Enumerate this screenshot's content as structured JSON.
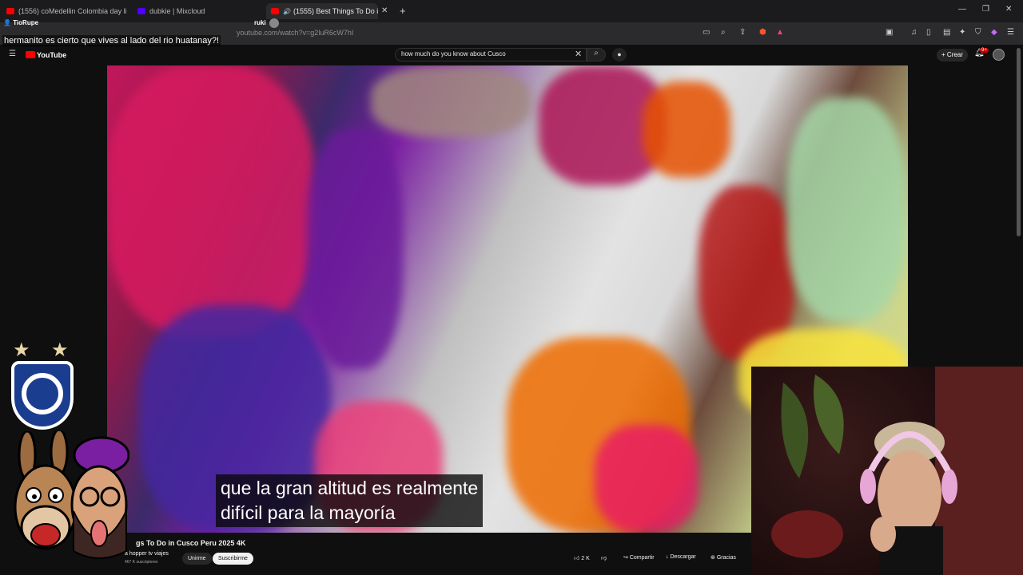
{
  "tabs": [
    {
      "label": "(1556) coMedellin Colombia day life",
      "favicon_color": "#ff0000"
    },
    {
      "label": "dubkie | Mixcloud",
      "favicon_color": "#5000ff"
    },
    {
      "label": "(1555) Best Things To Do in C",
      "favicon_color": "#ff0000",
      "active": true
    }
  ],
  "browser": {
    "url": "youtube.com/watch?v=g2luR6cW7hI"
  },
  "chat": {
    "user": "TioRupe",
    "user2": "ruki",
    "message": "hermanito es cierto que vives al lado del rio huatanay?!"
  },
  "youtube": {
    "logo_text": "YouTube",
    "search_query": "how much do you know about Cusco",
    "create_label": "Crear",
    "notification_count": "9+"
  },
  "video": {
    "caption_line1": "que la gran altitud es realmente",
    "caption_line2": "difícil para la mayoría",
    "title": "gs To Do in Cusco Peru 2025 4K",
    "channel": "a hopper tv viajes",
    "subscribers": "467 K suscriptores",
    "join_label": "Unirme",
    "subscribe_label": "Suscribirme",
    "likes": "2 K",
    "share_label": "Compartir",
    "download_label": "Descargar",
    "thanks_label": "Gracias"
  },
  "colors": {
    "youtube_red": "#ff0000",
    "background": "#0f0f0f",
    "crest_blue": "#1b3d8f"
  }
}
